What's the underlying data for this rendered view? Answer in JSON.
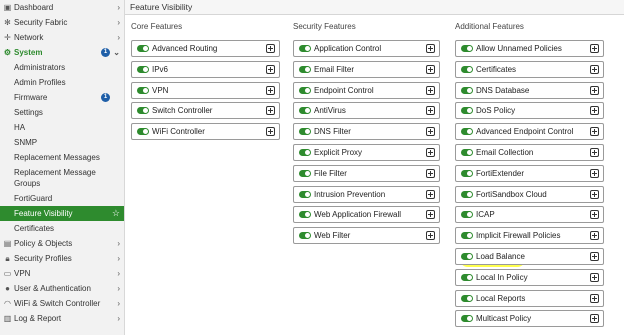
{
  "sidebar": {
    "items": [
      {
        "label": "Dashboard",
        "icon": "dashboard-icon"
      },
      {
        "label": "Security Fabric",
        "icon": "security-fabric-icon"
      },
      {
        "label": "Network",
        "icon": "network-icon"
      },
      {
        "label": "System",
        "icon": "gear-icon",
        "badge": "1"
      },
      {
        "label": "Administrators"
      },
      {
        "label": "Admin Profiles"
      },
      {
        "label": "Firmware",
        "badge": "1"
      },
      {
        "label": "Settings"
      },
      {
        "label": "HA"
      },
      {
        "label": "SNMP"
      },
      {
        "label": "Replacement Messages"
      },
      {
        "label": "Replacement Message Groups"
      },
      {
        "label": "FortiGuard"
      },
      {
        "label": "Feature Visibility"
      },
      {
        "label": "Certificates"
      },
      {
        "label": "Policy & Objects",
        "icon": "policy-icon"
      },
      {
        "label": "Security Profiles",
        "icon": "lock-icon"
      },
      {
        "label": "VPN",
        "icon": "monitor-icon"
      },
      {
        "label": "User & Authentication",
        "icon": "user-icon"
      },
      {
        "label": "WiFi & Switch Controller",
        "icon": "wifi-icon"
      },
      {
        "label": "Log & Report",
        "icon": "chart-icon"
      }
    ]
  },
  "header": {
    "title": "Feature Visibility"
  },
  "columns": {
    "core": {
      "title": "Core Features",
      "items": [
        "Advanced Routing",
        "IPv6",
        "VPN",
        "Switch Controller",
        "WiFi Controller"
      ]
    },
    "security": {
      "title": "Security Features",
      "items": [
        "Application Control",
        "Email Filter",
        "Endpoint Control",
        "AntiVirus",
        "DNS Filter",
        "Explicit Proxy",
        "File Filter",
        "Intrusion Prevention",
        "Web Application Firewall",
        "Web Filter"
      ]
    },
    "additional": {
      "title": "Additional Features",
      "items": [
        "Allow Unnamed Policies",
        "Certificates",
        "DNS Database",
        "DoS Policy",
        "Advanced Endpoint Control",
        "Email Collection",
        "FortiExtender",
        "FortiSandbox Cloud",
        "ICAP",
        "Implicit Firewall Policies",
        "Load Balance",
        "Local In Policy",
        "Local Reports",
        "Multicast Policy"
      ]
    }
  },
  "colors": {
    "accent": "#2e8b2e",
    "badge": "#1f5fa8",
    "highlight": "#ffff3a"
  }
}
